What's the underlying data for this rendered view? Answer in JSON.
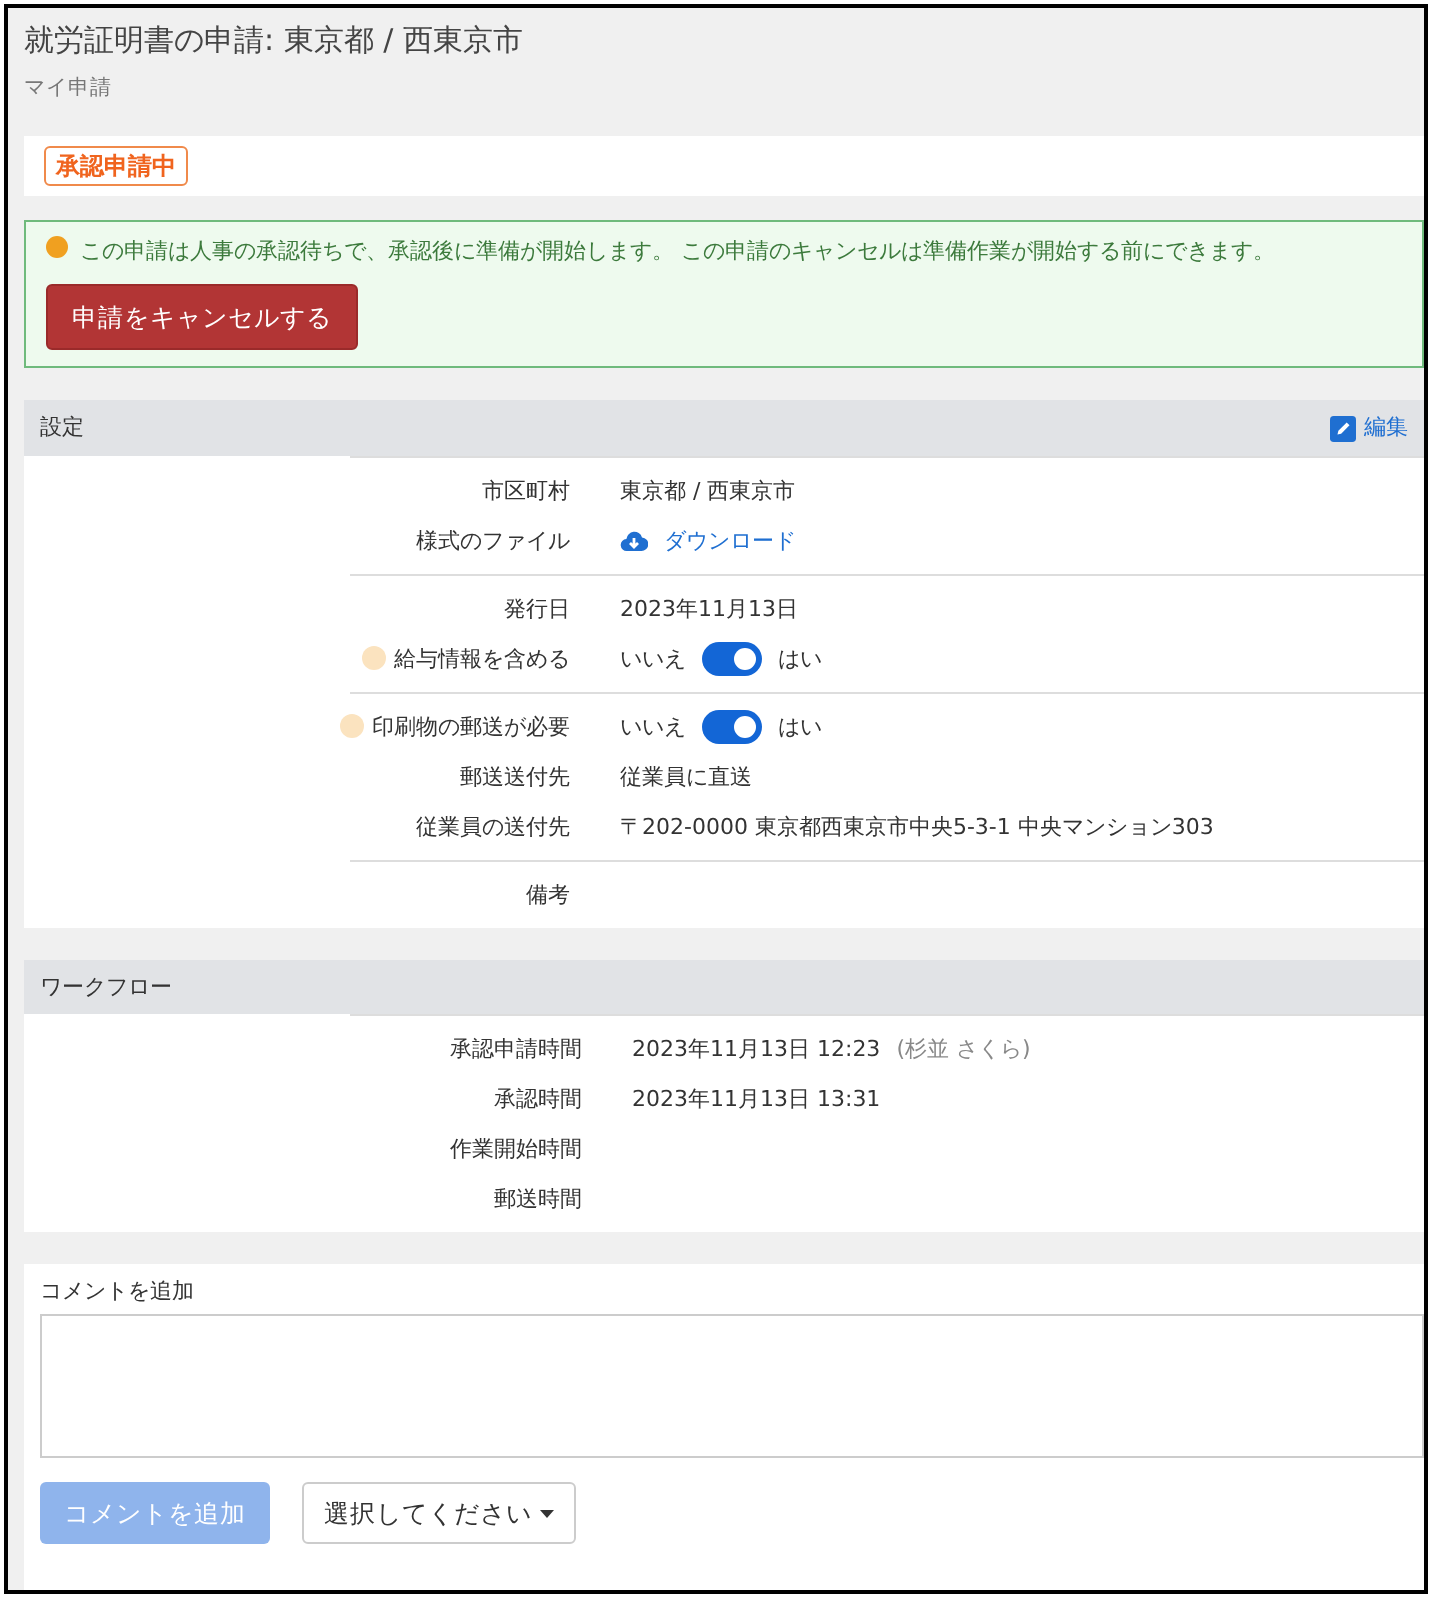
{
  "title": "就労証明書の申請: 東京都 / 西東京市",
  "breadcrumb": "マイ申請",
  "status_badge": "承認申請中",
  "alert": {
    "message": "この申請は人事の承認待ちで、承認後に準備が開始します。 この申請のキャンセルは準備作業が開始する前にできます。",
    "button": "申請をキャンセルする"
  },
  "settings": {
    "title": "設定",
    "edit_link": "編集",
    "groups": [
      {
        "rows": [
          {
            "kind": "text",
            "label": "市区町村",
            "value": "東京都 / 西東京市"
          },
          {
            "kind": "link",
            "label": "様式のファイル",
            "value": "ダウンロード"
          }
        ]
      },
      {
        "rows": [
          {
            "kind": "text",
            "label": "発行日",
            "value": "2023年11月13日"
          },
          {
            "kind": "toggle",
            "help": true,
            "label": "給与情報を含める",
            "off_label": "いいえ",
            "on_label": "はい",
            "on": true
          }
        ]
      },
      {
        "rows": [
          {
            "kind": "toggle",
            "help": true,
            "label": "印刷物の郵送が必要",
            "off_label": "いいえ",
            "on_label": "はい",
            "on": true
          },
          {
            "kind": "text",
            "label": "郵送送付先",
            "value": "従業員に直送"
          },
          {
            "kind": "text",
            "label": "従業員の送付先",
            "value": "〒202-0000 東京都西東京市中央5-3-1 中央マンション303"
          }
        ]
      },
      {
        "rows": [
          {
            "kind": "text",
            "label": "備考"
          }
        ]
      }
    ]
  },
  "workflow": {
    "title": "ワークフロー",
    "rows": [
      {
        "label": "承認申請時間",
        "value": "2023年11月13日 12:23",
        "note": "(杉並 さくら)"
      },
      {
        "label": "承認時間",
        "value": "2023年11月13日 13:31"
      },
      {
        "label": "作業開始時間"
      },
      {
        "label": "郵送時間"
      }
    ]
  },
  "comment": {
    "label": "コメントを追加",
    "submit": {
      "label": "コメントを追加",
      "disabled": true
    },
    "select": "選択してください"
  }
}
